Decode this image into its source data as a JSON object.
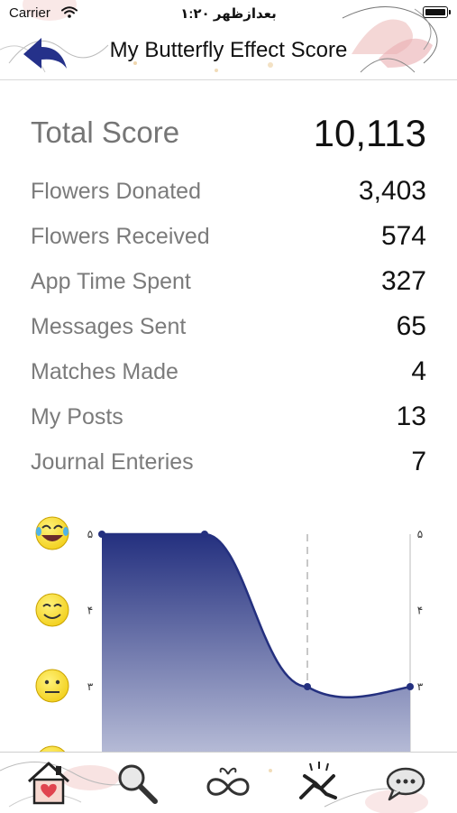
{
  "status_bar": {
    "carrier": "Carrier",
    "time": "۱:۲۰ بعدازظهر"
  },
  "header": {
    "title": "My Butterfly Effect Score"
  },
  "scores": {
    "total_label": "Total Score",
    "total_value": "10,113",
    "items": [
      {
        "label": "Flowers Donated",
        "value": "3,403"
      },
      {
        "label": "Flowers Received",
        "value": "574"
      },
      {
        "label": "App Time Spent",
        "value": "327"
      },
      {
        "label": "Messages Sent",
        "value": "65"
      },
      {
        "label": "Matches Made",
        "value": "4"
      },
      {
        "label": "My Posts",
        "value": "13"
      },
      {
        "label": "Journal Enteries",
        "value": "7"
      }
    ]
  },
  "chart_data": {
    "type": "area",
    "x": [
      0,
      1,
      2,
      3
    ],
    "values": [
      5,
      5,
      3,
      3
    ],
    "ylim": [
      2,
      5
    ],
    "y_tick_labels": [
      "۵",
      "۴",
      "۳"
    ],
    "y_tick_values": [
      5,
      4,
      3
    ],
    "left_axis_icons": [
      "laughing-face-icon",
      "smiling-face-icon",
      "neutral-face-icon"
    ],
    "fill_color_top": "#24307f",
    "fill_color_bottom": "#b9bed8",
    "line_color": "#24307f",
    "highlight_index": 2
  },
  "tab_bar": {
    "items": [
      {
        "icon": "home-heart-icon",
        "name": "home"
      },
      {
        "icon": "search-icon",
        "name": "search"
      },
      {
        "icon": "infinity-icon",
        "name": "infinity"
      },
      {
        "icon": "handshake-icon",
        "name": "handshake"
      },
      {
        "icon": "chat-bubbles-icon",
        "name": "chat"
      }
    ]
  },
  "colors": {
    "accent": "#24307f",
    "label_gray": "#7b7b7b",
    "value_black": "#111111"
  }
}
